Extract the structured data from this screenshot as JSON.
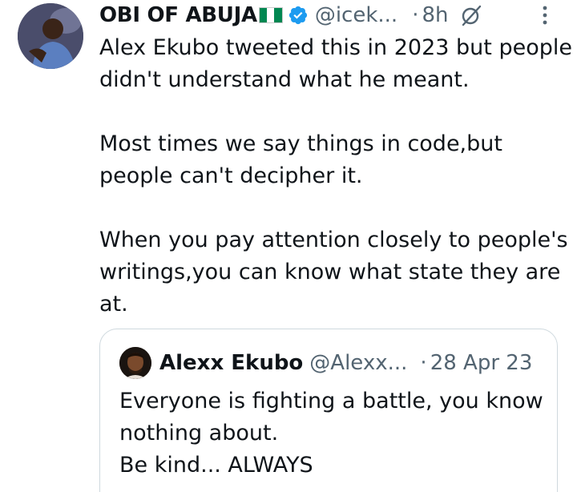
{
  "tweet": {
    "author": {
      "display_name": "OBI OF ABUJA",
      "flag_icon": "nigeria-flag-icon",
      "verified_icon": "verified-badge-icon",
      "handle": "@icek...",
      "time": "8h",
      "separator": "·"
    },
    "text": "Alex Ekubo tweeted this in 2023 but people didn't understand what he meant.\n\nMost times we say things in code,but people can't decipher it.\n\nWhen you pay attention closely to people's writings,you can know what state they are at.",
    "quoted": {
      "display_name": "Alexx Ekubo",
      "handle": "@Alexx...",
      "separator": "·",
      "date": "28 Apr 23",
      "text": "Everyone is fighting a battle, you know nothing about.\nBe kind...  ALWAYS"
    }
  },
  "colors": {
    "text": "#0f1419",
    "secondary": "#536471",
    "verified": "#1d9bf0",
    "border": "#cfd9de",
    "flag_green": "#008751",
    "flag_white": "#ffffff"
  },
  "icons": {
    "grok": "grok-icon",
    "more": "more-options-icon"
  }
}
